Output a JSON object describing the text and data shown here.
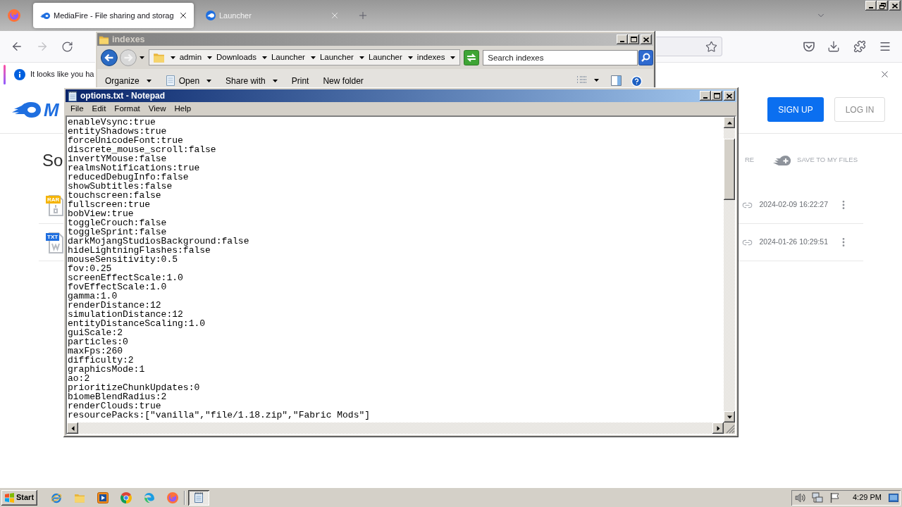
{
  "browser": {
    "tabs": [
      {
        "title": "MediaFire - File sharing and storag",
        "selected": true
      },
      {
        "title": "Launcher",
        "selected": false
      }
    ],
    "back": {
      "disabled": false
    },
    "forward": {
      "disabled": true
    },
    "notification": {
      "text": "It looks like you ha"
    }
  },
  "page": {
    "logo_text": "M",
    "auth_buttons": [
      {
        "label": "SIGN UP",
        "kind": "primary"
      },
      {
        "label": "LOG IN",
        "kind": "outline"
      }
    ],
    "heading": "So",
    "actions": [
      {
        "label": "RE",
        "kind": "text"
      },
      {
        "label": "SAVE TO MY FILES",
        "kind": "save"
      }
    ],
    "files": [
      {
        "type": "RAR",
        "color": "#f5b400",
        "date": "2024-02-09 16:22:27"
      },
      {
        "type": "TXT",
        "color": "#1f6fe0",
        "date": "2024-01-26 10:29:51"
      }
    ]
  },
  "explorer": {
    "title": "indexes",
    "back": {
      "disabled": false
    },
    "forward": {
      "disabled": true
    },
    "path": [
      "admin",
      "Downloads",
      "Launcher",
      "Launcher",
      "Launcher",
      "indexes"
    ],
    "search": {
      "placeholder": "Search indexes"
    },
    "toolbar": [
      {
        "label": "Organize",
        "dropdown": true,
        "icon": false
      },
      {
        "label": "Open",
        "dropdown": true,
        "icon": true
      },
      {
        "label": "Share with",
        "dropdown": true,
        "icon": false
      },
      {
        "label": "Print",
        "dropdown": false,
        "icon": false
      },
      {
        "label": "New folder",
        "dropdown": false,
        "icon": false
      }
    ]
  },
  "notepad": {
    "title": "options.txt - Notepad",
    "menu": [
      "File",
      "Edit",
      "Format",
      "View",
      "Help"
    ],
    "lines": [
      "enableVsync:true",
      "entityShadows:true",
      "forceUnicodeFont:true",
      "discrete_mouse_scroll:false",
      "invertYMouse:false",
      "realmsNotifications:true",
      "reducedDebugInfo:false",
      "showSubtitles:false",
      "touchscreen:false",
      "fullscreen:true",
      "bobView:true",
      "toggleCrouch:false",
      "toggleSprint:false",
      "darkMojangStudiosBackground:false",
      "hideLightningFlashes:false",
      "mouseSensitivity:0.5",
      "fov:0.25",
      "screenEffectScale:1.0",
      "fovEffectScale:1.0",
      "gamma:1.0",
      "renderDistance:12",
      "simulationDistance:12",
      "entityDistanceScaling:1.0",
      "guiScale:2",
      "particles:0",
      "maxFps:260",
      "difficulty:2",
      "graphicsMode:1",
      "ao:2",
      "prioritizeChunkUpdates:0",
      "biomeBlendRadius:2",
      "renderClouds:true",
      "resourcePacks:[\"vanilla\",\"file/1.18.zip\",\"Fabric Mods\"]"
    ]
  },
  "taskbar": {
    "start": "Start",
    "tasks": [
      {
        "selected": true
      }
    ],
    "clock": "4:29 PM"
  }
}
